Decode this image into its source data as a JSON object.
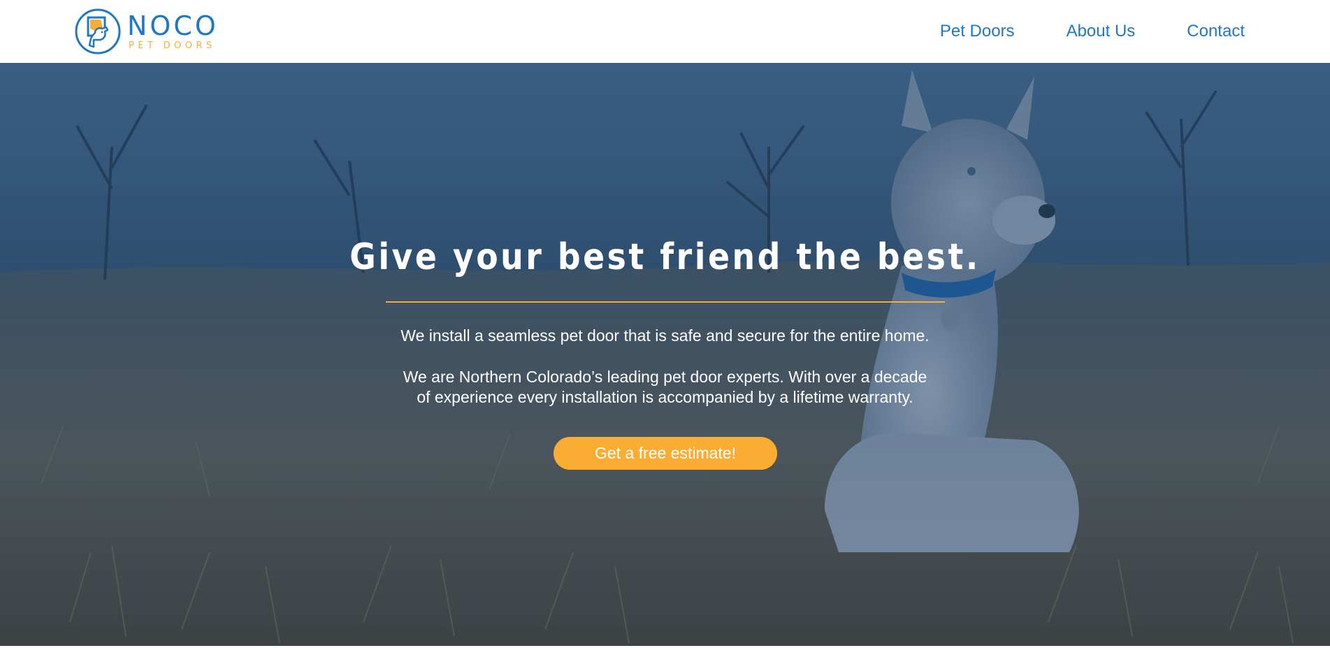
{
  "brand": {
    "name": "NOCO",
    "sub": "PET DOORS",
    "colors": {
      "primary": "#1f78c2",
      "accent": "#f9ad33"
    },
    "icon": "dog-in-door-logo-icon"
  },
  "nav": {
    "items": [
      {
        "label": "Pet Doors"
      },
      {
        "label": "About Us"
      },
      {
        "label": "Contact"
      }
    ]
  },
  "hero": {
    "background": "husky-puppy-sitting-in-grass-photo",
    "overlay_color": "#1d3f66",
    "title": "Give your best friend the best.",
    "paragraph1": "We install a seamless pet door that is safe and secure for the entire home.",
    "paragraph2_line1": "We are Northern Colorado’s leading pet door experts. With over a decade",
    "paragraph2_line2": "of experience every installation is accompanied by a lifetime warranty.",
    "cta_label": "Get a free estimate!"
  }
}
